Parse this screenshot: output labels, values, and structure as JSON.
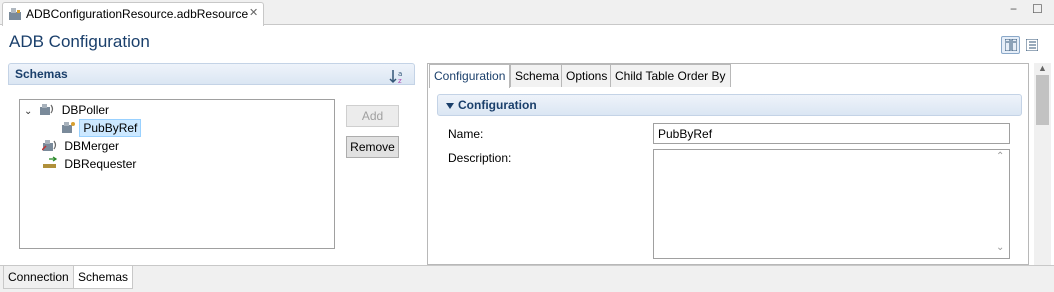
{
  "editor_tab": {
    "title": "ADBConfigurationResource.adbResource",
    "close_glyph": "✕"
  },
  "window_controls": {
    "minimize": "−",
    "maximize": "☐"
  },
  "page": {
    "title": "ADB Configuration"
  },
  "schemas_section": {
    "title": "Schemas",
    "tree": [
      {
        "label": "DBPoller",
        "expanded": true,
        "icon": "db-poller-icon"
      },
      {
        "label": "PubByRef",
        "selected": true,
        "icon": "publisher-icon"
      },
      {
        "label": "DBMerger",
        "icon": "db-merger-icon"
      },
      {
        "label": "DBRequester",
        "icon": "db-requester-icon"
      }
    ],
    "add_label": "Add",
    "remove_label": "Remove"
  },
  "detail_tabs": [
    "Configuration",
    "Schema",
    "Options",
    "Child Table Order By"
  ],
  "configuration": {
    "title": "Configuration",
    "name_label": "Name:",
    "name_value": "PubByRef",
    "description_label": "Description:"
  },
  "bottom_tabs": [
    "Connection",
    "Schemas"
  ],
  "colors": {
    "accent": "#1a3f6b",
    "selection": "#cce8ff",
    "section_bg": "#dbe6f3"
  }
}
